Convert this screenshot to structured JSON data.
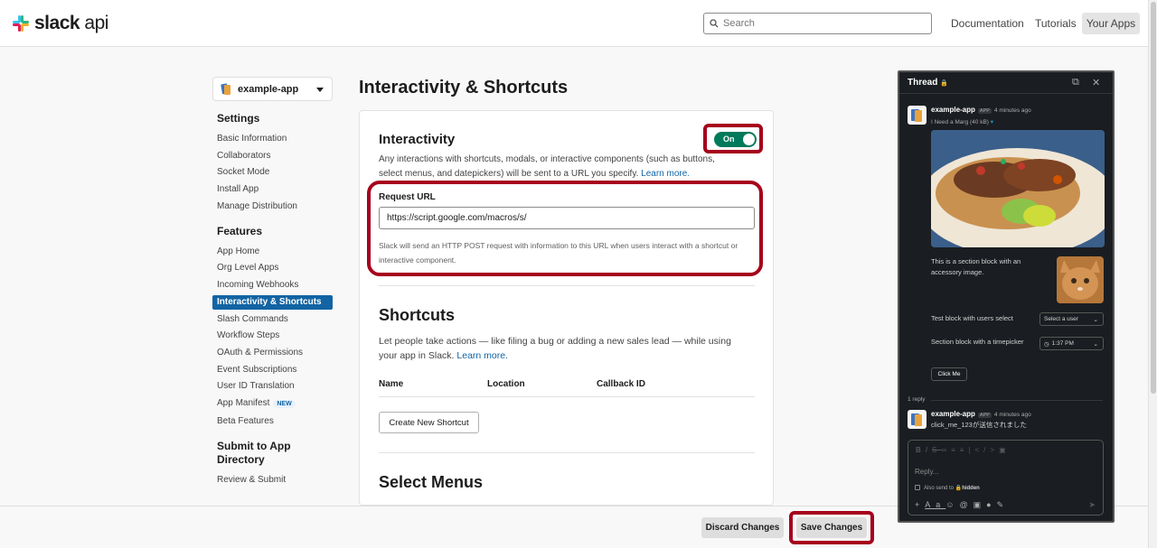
{
  "header": {
    "logo_text": "slack",
    "logo_suffix": "api",
    "search_placeholder": "Search",
    "nav": {
      "documentation": "Documentation",
      "tutorials": "Tutorials",
      "your_apps": "Your Apps"
    }
  },
  "sidebar": {
    "app_name": "example-app",
    "sections": [
      {
        "title": "Settings",
        "items": [
          "Basic Information",
          "Collaborators",
          "Socket Mode",
          "Install App",
          "Manage Distribution"
        ]
      },
      {
        "title": "Features",
        "items": [
          "App Home",
          "Org Level Apps",
          "Incoming Webhooks",
          "Interactivity & Shortcuts",
          "Slash Commands",
          "Workflow Steps",
          "OAuth & Permissions",
          "Event Subscriptions",
          "User ID Translation",
          "App Manifest",
          "Beta Features"
        ]
      },
      {
        "title": "Submit to App Directory",
        "items": [
          "Review & Submit"
        ]
      }
    ],
    "new_badge": "NEW",
    "active_item": "Interactivity & Shortcuts"
  },
  "main": {
    "title": "Interactivity & Shortcuts",
    "interactivity": {
      "heading": "Interactivity",
      "toggle_label": "On",
      "toggle_on": true,
      "description": "Any interactions with shortcuts, modals, or interactive components (such as buttons, select menus, and datepickers) will be sent to a URL you specify.",
      "learn_more": "Learn more.",
      "request_url_label": "Request URL",
      "request_url_value": "https://script.google.com/macros/s/",
      "request_url_help": "Slack will send an HTTP POST request with information to this URL when users interact with a shortcut or interactive component."
    },
    "shortcuts": {
      "heading": "Shortcuts",
      "description": "Let people take actions — like filing a bug or adding a new sales lead — while using your app in Slack.",
      "learn_more": "Learn more.",
      "columns": [
        "Name",
        "Location",
        "Callback ID"
      ],
      "create_button": "Create New Shortcut"
    },
    "select_menus": {
      "heading": "Select Menus"
    }
  },
  "footer": {
    "discard": "Discard Changes",
    "save": "Save Changes"
  },
  "thread": {
    "title": "Thread",
    "message1": {
      "author": "example-app",
      "tag": "APP",
      "time": "4 minutes ago",
      "file": "I Need a Marg (40 kB)",
      "section_text": "This is a section block with an accessory image.",
      "users_select_label": "Test block with users select",
      "users_select_placeholder": "Select a user",
      "timepicker_label": "Section block with a timepicker",
      "timepicker_value": "1:37 PM",
      "button": "Click Me"
    },
    "reply_count": "1 reply",
    "message2": {
      "author": "example-app",
      "tag": "APP",
      "time": "4 minutes ago",
      "text": "click_me_123が送信されました"
    },
    "reply_placeholder": "Reply...",
    "also_send_to": "Also send to",
    "channel": "hidden"
  }
}
